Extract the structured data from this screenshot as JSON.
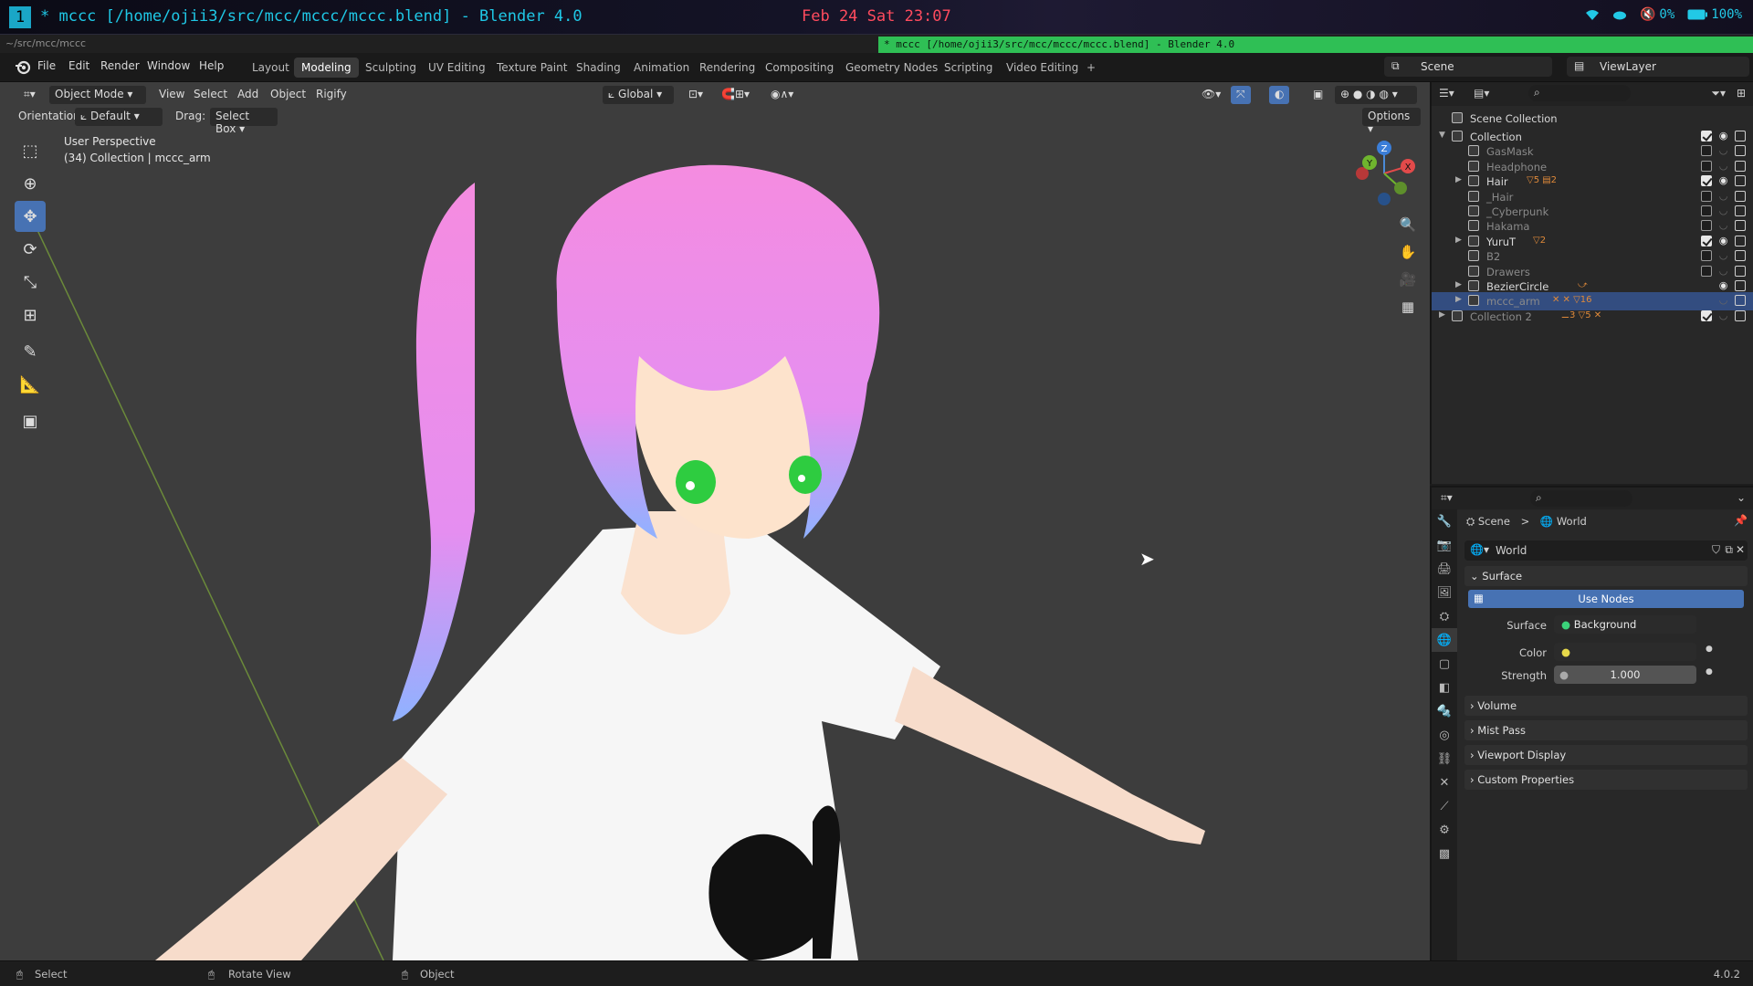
{
  "system_bar": {
    "workspace": "1",
    "window_title": "* mccc [/home/ojii3/src/mcc/mccc/mccc.blend] - Blender 4.0",
    "clock": "Feb 24 Sat  23:07",
    "volume": "0%",
    "battery": "100%"
  },
  "path_bar": {
    "path": "~/src/mcc/mccc",
    "tooltip_title": "* mccc [/home/ojii3/src/mcc/mccc/mccc.blend] - Blender 4.0"
  },
  "menu": {
    "items": [
      "File",
      "Edit",
      "Render",
      "Window",
      "Help"
    ]
  },
  "workspaces": {
    "tabs": [
      "Layout",
      "Modeling",
      "Sculpting",
      "UV Editing",
      "Texture Paint",
      "Shading",
      "Animation",
      "Rendering",
      "Compositing",
      "Geometry Nodes",
      "Scripting",
      "Video Editing"
    ],
    "active": "Modeling",
    "add": "+"
  },
  "scene": {
    "name": "Scene",
    "view_layer": "ViewLayer"
  },
  "viewport_header": {
    "mode": "Object Mode",
    "menus": [
      "View",
      "Select",
      "Add",
      "Object",
      "Rigify"
    ],
    "transform": "Global",
    "orientation_label": "Orientation:",
    "orientation_value": "Default",
    "drag_label": "Drag:",
    "drag_value": "Select Box",
    "options": "Options"
  },
  "viewport": {
    "perspective": "User Perspective",
    "context": "(34) Collection | mccc_arm",
    "gizmo": {
      "z": "Z",
      "y": "Y",
      "x": "X"
    }
  },
  "outliner": {
    "root": "Scene Collection",
    "rows": [
      {
        "label": "Collection",
        "indent": 1,
        "arrow": "▼",
        "dim": false,
        "checked": true,
        "visible": true
      },
      {
        "label": "GasMask",
        "indent": 2,
        "arrow": "",
        "dim": true,
        "checked": false,
        "visible": false
      },
      {
        "label": "Headphone",
        "indent": 2,
        "arrow": "",
        "dim": true,
        "checked": false,
        "visible": false
      },
      {
        "label": "Hair",
        "indent": 2,
        "arrow": "▶",
        "dim": false,
        "checked": true,
        "visible": true,
        "badge": "▽5 ▤2"
      },
      {
        "label": "_Hair",
        "indent": 2,
        "arrow": "",
        "dim": true,
        "checked": false,
        "visible": false
      },
      {
        "label": "_Cyberpunk",
        "indent": 2,
        "arrow": "",
        "dim": true,
        "checked": false,
        "visible": false
      },
      {
        "label": "Hakama",
        "indent": 2,
        "arrow": "",
        "dim": true,
        "checked": false,
        "visible": false
      },
      {
        "label": "YuruT",
        "indent": 2,
        "arrow": "▶",
        "dim": false,
        "checked": true,
        "visible": true,
        "badge": "▽2"
      },
      {
        "label": "B2",
        "indent": 2,
        "arrow": "",
        "dim": true,
        "checked": false,
        "visible": false
      },
      {
        "label": "Drawers",
        "indent": 2,
        "arrow": "",
        "dim": true,
        "checked": false,
        "visible": false
      },
      {
        "label": "BezierCircle",
        "indent": 2,
        "arrow": "▶",
        "dim": false,
        "checked": null,
        "visible": true,
        "badge": "⤻"
      },
      {
        "label": "mccc_arm",
        "indent": 2,
        "arrow": "▶",
        "dim": true,
        "checked": null,
        "visible": false,
        "badge": "✕ ✕ ▽16",
        "selected": true
      },
      {
        "label": "Collection 2",
        "indent": 1,
        "arrow": "▶",
        "dim": true,
        "checked": true,
        "visible": false,
        "badge": "⚊3 ▽5 ✕"
      }
    ]
  },
  "properties": {
    "breadcrumb": {
      "scene": "Scene",
      "separator": ">",
      "world": "World"
    },
    "datablock": "World",
    "surface_panel": "Surface",
    "use_nodes": "Use Nodes",
    "surface_label": "Surface",
    "surface_value": "Background",
    "color_label": "Color",
    "strength_label": "Strength",
    "strength_value": "1.000",
    "panels": [
      "Volume",
      "Mist Pass",
      "Viewport Display",
      "Custom Properties"
    ]
  },
  "status_bar": {
    "select": "Select",
    "rotate": "Rotate View",
    "object": "Object",
    "version": "4.0.2"
  },
  "colors": {
    "accent": "#4772b3",
    "use_nodes_bg": "#4772b3",
    "outliner_selected": "#334d80",
    "title_cyan": "#1fc8e6",
    "clock_red": "#ff4b5e",
    "tooltip_green": "#2fbf55",
    "hair_pink": "#f28ee0",
    "hair_blue": "#8fb2ff",
    "eye_green": "#2ecc40",
    "skin": "#fde3cc",
    "shirt": "#f6f6f6"
  }
}
